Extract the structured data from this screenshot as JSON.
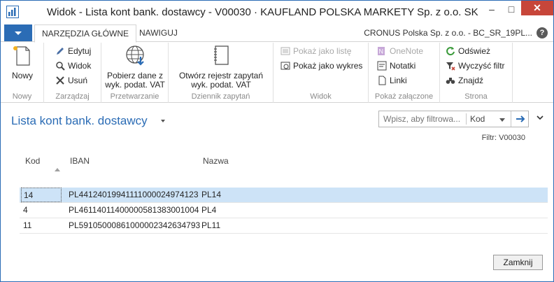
{
  "window": {
    "title": "Widok - Lista kont bank. dostawcy - V00030 · KAUFLAND POLSKA MARKETY Sp. z o.o. SK",
    "minimize": "–",
    "maximize": "□",
    "close": "✕"
  },
  "tabs": {
    "home": "NARZĘDZIA GŁÓWNE",
    "navigate": "NAWIGUJ"
  },
  "company": "CRONUS Polska Sp. z o.o. - BC_SR_19PL...",
  "help": "?",
  "ribbon": {
    "new": {
      "label": "Nowy",
      "group": "Nowy"
    },
    "manage": {
      "edit": "Edytuj",
      "view": "Widok",
      "delete": "Usuń",
      "group": "Zarządzaj"
    },
    "process": {
      "fetch_line1": "Pobierz dane z",
      "fetch_line2": "wyk. podat. VAT",
      "group": "Przetwarzanie"
    },
    "log": {
      "open_line1": "Otwórz rejestr zapytań",
      "open_line2": "wyk. podat. VAT",
      "group": "Dziennik zapytań"
    },
    "view": {
      "list": "Pokaż jako listę",
      "chart": "Pokaż jako wykres",
      "group": "Widok"
    },
    "attached": {
      "onenote": "OneNote",
      "notes": "Notatki",
      "links": "Linki",
      "group": "Pokaż załączone"
    },
    "page": {
      "refresh": "Odśwież",
      "clear_filter": "Wyczyść filtr",
      "find": "Znajdź",
      "group": "Strona"
    }
  },
  "page": {
    "title": "Lista kont bank. dostawcy",
    "filter_placeholder": "Wpisz, aby filtrowa...",
    "filter_field": "Kod",
    "filter_info": "Filtr: V00030"
  },
  "table": {
    "headers": {
      "code": "Kod",
      "iban": "IBAN",
      "name": "Nazwa"
    },
    "rows": [
      {
        "code": "14",
        "iban": "PL44124019941111000024974123",
        "name": "PL14"
      },
      {
        "code": "4",
        "iban": "PL46114011400000581383001004",
        "name": "PL4"
      },
      {
        "code": "11",
        "iban": "PL59105000861000002342634793",
        "name": "PL11"
      }
    ]
  },
  "close_button": "Zamknij",
  "colors": {
    "accent": "#2b6cb5",
    "selected_row": "#cde3f7",
    "close_red": "#c7463a"
  }
}
